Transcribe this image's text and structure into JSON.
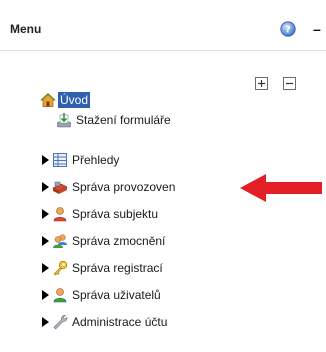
{
  "header": {
    "title": "Menu",
    "help_icon": "help-icon",
    "minimize_icon": "minimize-icon"
  },
  "tree_controls": {
    "expand_icon": "expand-all-icon",
    "collapse_icon": "collapse-all-icon"
  },
  "menu": {
    "items": [
      {
        "label": "Úvod",
        "icon": "home-icon",
        "expandable": false,
        "active": true
      },
      {
        "label": "Stažení formuláře",
        "icon": "download-form-icon",
        "expandable": false,
        "active": false
      },
      {
        "label": "Přehledy",
        "icon": "table-icon",
        "expandable": true,
        "active": false
      },
      {
        "label": "Správa provozoven",
        "icon": "establishments-icon",
        "expandable": true,
        "active": false
      },
      {
        "label": "Správa subjektu",
        "icon": "user-icon",
        "expandable": true,
        "active": false
      },
      {
        "label": "Správa zmocnění",
        "icon": "users-icon",
        "expandable": true,
        "active": false
      },
      {
        "label": "Správa registrací",
        "icon": "key-icon",
        "expandable": true,
        "active": false
      },
      {
        "label": "Správa uživatelů",
        "icon": "user-green-icon",
        "expandable": true,
        "active": false
      },
      {
        "label": "Administrace účtu",
        "icon": "wrench-icon",
        "expandable": true,
        "active": false
      }
    ]
  },
  "annotation": {
    "arrow_color": "#e31e24",
    "points_to": "Správa provozoven"
  },
  "colors": {
    "active_bg": "#2f5fae",
    "active_text": "#ffffff"
  }
}
